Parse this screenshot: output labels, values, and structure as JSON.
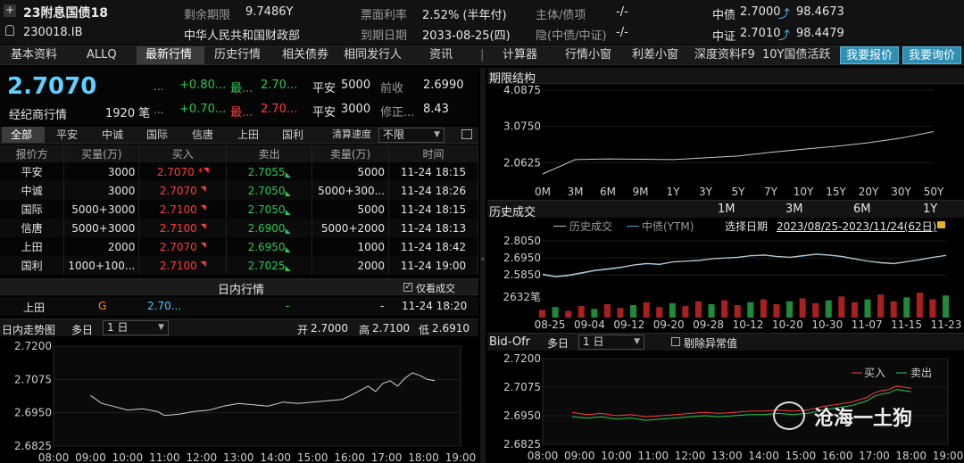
{
  "header": {
    "bond_name": "23附息国债18",
    "bond_code": "230018.IB",
    "issuer": "中华人民共和国财政部",
    "remaining_term_label": "剩余期限",
    "remaining_term": "9.7486Y",
    "coupon_label": "票面利率",
    "coupon": "2.52% (半年付)",
    "maturity_label": "到期日期",
    "maturity": "2033-08-25(四)",
    "rating_label": "主体/债项",
    "rating": "-/-",
    "implied_label": "隐(中债/中证)",
    "implied": "-/-",
    "cb_label": "中债",
    "cb_yield": "2.7000",
    "cb_price": "98.4673",
    "cs_label": "中证",
    "cs_yield": "2.7010",
    "cs_price": "98.4479"
  },
  "nav": {
    "items": [
      "基本资料",
      "ALLQ",
      "最新行情",
      "历史行情",
      "相关债券",
      "相同发行人",
      "资讯",
      "|",
      "计算器",
      "行情小窗",
      "利差小窗",
      "深度资料F9"
    ],
    "highlight": "10Y国债活跃",
    "btn_quote": "我要报价",
    "btn_inquiry": "我要询价"
  },
  "summary": {
    "last": "2.7070",
    "last_label": "经纪商行情",
    "count": "1920 笔",
    "dots": "...",
    "row1_change": "+0.80...",
    "row1_tag": "最...",
    "row1_val": "2.70...",
    "row2_change": "+0.70...",
    "row2_tag": "最...",
    "row2_val": "2.70...",
    "r1_broker": "平安",
    "r1_qty": "5000",
    "r1_label": "前收",
    "r1_value": "2.6990",
    "r2_broker": "平安",
    "r2_qty": "3000",
    "r2_label": "修正...",
    "r2_value": "8.43"
  },
  "broker_tabs": [
    "全部",
    "平安",
    "中诚",
    "国际",
    "信唐",
    "上田",
    "国利"
  ],
  "clear_speed_label": "清算速度",
  "clear_speed_value": "不限",
  "book": {
    "columns": [
      "报价方",
      "买量(万)",
      "买入",
      "卖出",
      "卖量(万)",
      "时间"
    ],
    "rows": [
      {
        "broker": "平安",
        "bid_qty": "3000",
        "bid": "2.7070",
        "bid_flag": "*",
        "ask": "2.7055",
        "ask_qty": "5000",
        "time": "11-24 18:15"
      },
      {
        "broker": "中诚",
        "bid_qty": "3000",
        "bid": "2.7070",
        "bid_flag": "",
        "ask": "2.7050",
        "ask_qty": "5000+300...",
        "time": "11-24 18:26"
      },
      {
        "broker": "国际",
        "bid_qty": "5000+3000",
        "bid": "2.7100",
        "bid_flag": "",
        "ask": "2.7050",
        "ask_qty": "5000",
        "time": "11-24 18:15"
      },
      {
        "broker": "信唐",
        "bid_qty": "5000+3000",
        "bid": "2.7100",
        "bid_flag": "",
        "ask": "2.6900",
        "ask_qty": "5000+2000",
        "time": "11-24 18:13"
      },
      {
        "broker": "上田",
        "bid_qty": "2000",
        "bid": "2.7070",
        "bid_flag": "",
        "ask": "2.6950",
        "ask_qty": "1000",
        "time": "11-24 18:42"
      },
      {
        "broker": "国利",
        "bid_qty": "1000+100...",
        "bid": "2.7100",
        "bid_flag": "",
        "ask": "2.7025",
        "ask_qty": "2000",
        "time": "11-24 19:00"
      }
    ]
  },
  "intraday": {
    "title": "日内行情",
    "only_trades_label": "仅看成交",
    "row": {
      "broker": "上田",
      "side": "G",
      "value": "2.70...",
      "dash1": "-",
      "dash2": "-",
      "time": "11-24 18:20"
    }
  },
  "trend": {
    "title": "日内走势图",
    "days_label": "多日",
    "days_value": "1 日",
    "open_label": "开",
    "open": "2.7000",
    "high_label": "高",
    "high": "2.7100",
    "low_label": "低",
    "low": "2.6910"
  },
  "term_structure": {
    "title": "期限结构"
  },
  "history": {
    "title": "历史成交",
    "periods": [
      "1M",
      "3M",
      "6M",
      "1Y"
    ],
    "legend_trade": "历史成交",
    "legend_cb": "中债(YTM)",
    "date_label": "选择日期",
    "date_range": "2023/08/25-2023/11/24(62日)"
  },
  "bidofr": {
    "title": "Bid-Ofr",
    "days_label": "多日",
    "days_value": "1 日",
    "exclude_label": "剔除异常值"
  },
  "watermark": "沧海一土狗",
  "colors": {
    "bid": "#ff3b3b",
    "ask": "#28c850",
    "accent": "#4fc3f7",
    "button": "#2f8fb3"
  },
  "chart_data": [
    {
      "type": "line",
      "name": "intraday-trend",
      "x_ticks": [
        "08:00",
        "09:00",
        "10:00",
        "11:00",
        "12:00",
        "13:00",
        "14:00",
        "15:00",
        "16:00",
        "17:00",
        "18:00",
        "19:00"
      ],
      "y_ticks": [
        "2.7200",
        "2.7075",
        "2.6950",
        "2.6825"
      ],
      "ylim": [
        2.6825,
        2.72
      ],
      "x": [
        9.0,
        9.3,
        9.6,
        10.0,
        10.4,
        10.8,
        11.0,
        11.4,
        11.8,
        12.2,
        12.6,
        13.0,
        13.4,
        13.8,
        14.2,
        14.6,
        15.0,
        15.4,
        15.8,
        16.1,
        16.3,
        16.5,
        16.7,
        16.9,
        17.1,
        17.3,
        17.5,
        17.7,
        17.9,
        18.1,
        18.3
      ],
      "y": [
        2.7015,
        2.6985,
        2.6975,
        2.696,
        2.6965,
        2.6955,
        2.694,
        2.6945,
        2.6955,
        2.696,
        2.6975,
        2.6985,
        2.698,
        2.6975,
        2.699,
        2.6985,
        2.699,
        2.6995,
        2.7,
        2.702,
        2.7035,
        2.705,
        2.703,
        2.706,
        2.707,
        2.705,
        2.708,
        2.71,
        2.709,
        2.7075,
        2.707
      ]
    },
    {
      "type": "line",
      "name": "term-structure",
      "categories": [
        "0M",
        "3M",
        "6M",
        "9M",
        "1Y",
        "3Y",
        "5Y",
        "7Y",
        "10Y",
        "15Y",
        "20Y",
        "30Y",
        "50Y"
      ],
      "y_ticks": [
        "4.0875",
        "3.0750",
        "2.0625"
      ],
      "ylim": [
        1.55,
        4.0875
      ],
      "values": [
        1.75,
        2.15,
        2.17,
        2.16,
        2.15,
        2.2,
        2.25,
        2.35,
        2.44,
        2.52,
        2.62,
        2.75,
        2.93
      ]
    },
    {
      "type": "line",
      "name": "history-trades",
      "x_ticks": [
        "08-25",
        "09-04",
        "09-12",
        "09-20",
        "09-28",
        "10-12",
        "10-20",
        "10-30",
        "11-07",
        "11-15",
        "11-23"
      ],
      "y_ticks": [
        "2.8050",
        "2.6950",
        "2.5850"
      ],
      "volume_label": "2632笔",
      "ylim": [
        2.54,
        2.84
      ],
      "series": [
        {
          "name": "历史成交",
          "values": [
            2.59,
            2.575,
            2.585,
            2.6,
            2.615,
            2.625,
            2.635,
            2.65,
            2.66,
            2.655,
            2.67,
            2.675,
            2.68,
            2.69,
            2.695,
            2.7,
            2.71,
            2.715,
            2.705,
            2.7,
            2.71,
            2.72,
            2.715,
            2.705,
            2.69,
            2.675,
            2.665,
            2.66,
            2.672,
            2.685,
            2.7,
            2.712
          ]
        },
        {
          "name": "中债(YTM)",
          "values": [
            2.585,
            2.572,
            2.58,
            2.595,
            2.612,
            2.62,
            2.632,
            2.648,
            2.657,
            2.652,
            2.668,
            2.673,
            2.677,
            2.688,
            2.693,
            2.697,
            2.708,
            2.712,
            2.703,
            2.698,
            2.707,
            2.717,
            2.712,
            2.702,
            2.687,
            2.673,
            2.662,
            2.657,
            2.67,
            2.682,
            2.698,
            2.71
          ]
        }
      ],
      "volume": [
        40,
        55,
        35,
        60,
        45,
        70,
        50,
        65,
        80,
        55,
        75,
        60,
        85,
        70,
        90,
        65,
        80,
        95,
        70,
        85,
        100,
        75,
        90,
        110,
        80,
        95,
        120,
        85,
        105,
        130,
        95,
        115
      ]
    },
    {
      "type": "line",
      "name": "bid-ofr",
      "x_ticks": [
        "08:00",
        "09:00",
        "10:00",
        "11:00",
        "12:00",
        "13:00",
        "14:00",
        "15:00",
        "16:00",
        "17:00",
        "18:00",
        "19:00"
      ],
      "y_ticks": [
        "2.7200",
        "2.7075",
        "2.6950",
        "2.6825"
      ],
      "ylim": [
        2.6825,
        2.72
      ],
      "series": [
        {
          "name": "买入",
          "x": [
            8.8,
            9.2,
            9.6,
            10.0,
            10.4,
            10.8,
            11.2,
            11.6,
            12.0,
            12.4,
            12.8,
            13.2,
            13.6,
            14.0,
            14.4,
            14.8,
            15.2,
            15.6,
            16.0,
            16.4,
            16.8,
            17.0,
            17.2,
            17.4,
            17.6,
            17.8,
            18.0
          ],
          "y": [
            2.6965,
            2.6955,
            2.696,
            2.695,
            2.6955,
            2.6945,
            2.695,
            2.6955,
            2.696,
            2.6965,
            2.696,
            2.6965,
            2.697,
            2.697,
            2.6975,
            2.697,
            2.6975,
            2.699,
            2.7,
            2.701,
            2.703,
            2.705,
            2.706,
            2.7065,
            2.708,
            2.7075,
            2.707
          ]
        },
        {
          "name": "卖出",
          "x": [
            8.8,
            9.2,
            9.6,
            10.0,
            10.4,
            10.8,
            11.2,
            11.6,
            12.0,
            12.4,
            12.8,
            13.2,
            13.6,
            14.0,
            14.4,
            14.8,
            15.2,
            15.6,
            16.0,
            16.4,
            16.8,
            17.0,
            17.2,
            17.4,
            17.6,
            17.8,
            18.0
          ],
          "y": [
            2.6945,
            2.694,
            2.6945,
            2.6935,
            2.694,
            2.693,
            2.6935,
            2.694,
            2.6945,
            2.695,
            2.6945,
            2.695,
            2.6955,
            2.6955,
            2.696,
            2.6955,
            2.696,
            2.6975,
            2.6985,
            2.6995,
            2.7015,
            2.7035,
            2.7045,
            2.705,
            2.7065,
            2.706,
            2.7055
          ]
        }
      ]
    }
  ]
}
